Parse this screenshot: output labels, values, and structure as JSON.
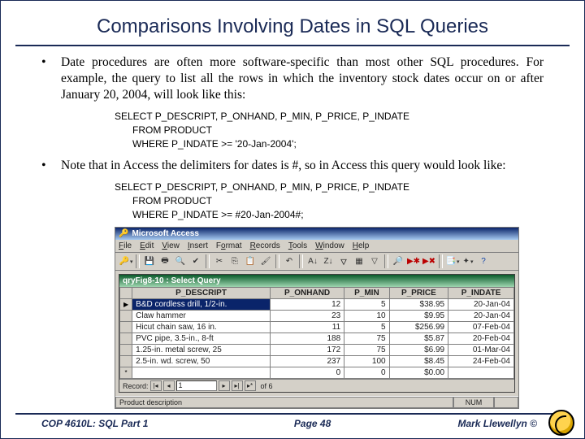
{
  "title": "Comparisons Involving Dates in SQL Queries",
  "bullets": [
    "Date procedures are often more software-specific than most other SQL procedures. For example, the query to list all the rows in which the inventory stock dates occur on or after January 20, 2004, will look like this:",
    "Note that in Access the delimiters for dates is #, so in Access this query would look like:"
  ],
  "code1": {
    "l1": "SELECT  P_DESCRIPT, P_ONHAND, P_MIN, P_PRICE, P_INDATE",
    "l2": "FROM PRODUCT",
    "l3": "WHERE P_INDATE >= '20-Jan-2004';"
  },
  "code2": {
    "l1": "SELECT  P_DESCRIPT, P_ONHAND, P_MIN, P_PRICE, P_INDATE",
    "l2": "FROM PRODUCT",
    "l3": "WHERE P_INDATE >= #20-Jan-2004#;"
  },
  "access": {
    "app_title": "Microsoft Access",
    "menu": {
      "file": "File",
      "edit": "Edit",
      "view": "View",
      "insert": "Insert",
      "format": "Format",
      "records": "Records",
      "tools": "Tools",
      "window": "Window",
      "help": "Help"
    },
    "subwin_title": "qryFig8-10 : Select Query",
    "columns": [
      "P_DESCRIPT",
      "P_ONHAND",
      "P_MIN",
      "P_PRICE",
      "P_INDATE"
    ],
    "rows": [
      {
        "desc": "B&D cordless drill, 1/2-in.",
        "onhand": "12",
        "min": "5",
        "price": "$38.95",
        "indate": "20-Jan-04"
      },
      {
        "desc": "Claw hammer",
        "onhand": "23",
        "min": "10",
        "price": "$9.95",
        "indate": "20-Jan-04"
      },
      {
        "desc": "Hicut chain saw, 16 in.",
        "onhand": "11",
        "min": "5",
        "price": "$256.99",
        "indate": "07-Feb-04"
      },
      {
        "desc": "PVC pipe, 3.5-in., 8-ft",
        "onhand": "188",
        "min": "75",
        "price": "$5.87",
        "indate": "20-Feb-04"
      },
      {
        "desc": "1.25-in. metal screw, 25",
        "onhand": "172",
        "min": "75",
        "price": "$6.99",
        "indate": "01-Mar-04"
      },
      {
        "desc": "2.5-in. wd. screw, 50",
        "onhand": "237",
        "min": "100",
        "price": "$8.45",
        "indate": "24-Feb-04"
      },
      {
        "desc": "",
        "onhand": "0",
        "min": "0",
        "price": "$0.00",
        "indate": ""
      }
    ],
    "nav_label": "Record:",
    "nav_value": "1",
    "nav_of": "of 6",
    "status_main": "Product description",
    "status_num": "NUM"
  },
  "footer": {
    "left": "COP 4610L: SQL Part 1",
    "center": "Page 48",
    "right": "Mark Llewellyn ©"
  }
}
